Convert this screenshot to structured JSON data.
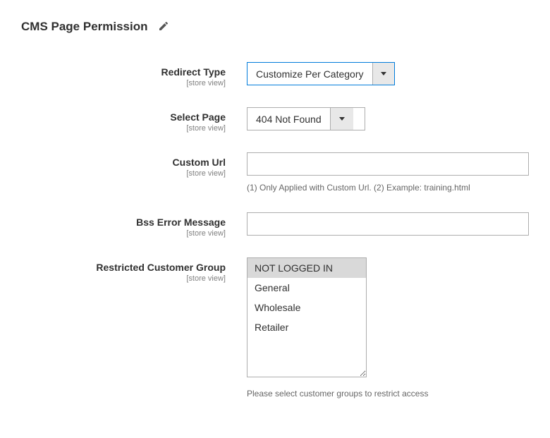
{
  "section": {
    "title": "CMS Page Permission"
  },
  "scope_label": "[store view]",
  "fields": {
    "redirect_type": {
      "label": "Redirect Type",
      "value": "Customize Per Category"
    },
    "select_page": {
      "label": "Select Page",
      "value": "404 Not Found"
    },
    "custom_url": {
      "label": "Custom Url",
      "value": "",
      "hint": "(1) Only Applied with Custom Url. (2) Example: training.html"
    },
    "error_message": {
      "label": "Bss Error Message",
      "value": ""
    },
    "restricted_group": {
      "label": "Restricted Customer Group",
      "options": [
        "NOT LOGGED IN",
        "General",
        "Wholesale",
        "Retailer"
      ],
      "selected": [
        "NOT LOGGED IN"
      ],
      "hint": "Please select customer groups to restrict access"
    }
  }
}
